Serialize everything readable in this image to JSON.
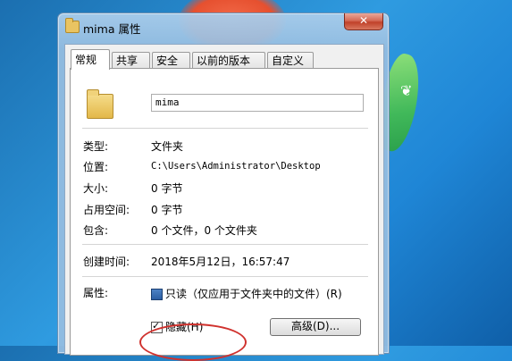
{
  "window": {
    "title": "mima 属性",
    "close_glyph": "✕"
  },
  "tabs": [
    {
      "label": "常规",
      "active": true
    },
    {
      "label": "共享",
      "active": false
    },
    {
      "label": "安全",
      "active": false
    },
    {
      "label": "以前的版本",
      "active": false
    },
    {
      "label": "自定义",
      "active": false
    }
  ],
  "folder_name": "mima",
  "props": {
    "type_label": "类型:",
    "type_value": "文件夹",
    "location_label": "位置:",
    "location_value": "C:\\Users\\Administrator\\Desktop",
    "size_label": "大小:",
    "size_value": "0 字节",
    "disk_label": "占用空间:",
    "disk_value": "0 字节",
    "contains_label": "包含:",
    "contains_value": "0 个文件，0 个文件夹",
    "created_label": "创建时间:",
    "created_value": "2018年5月12日，16:57:47",
    "attrs_label": "属性:"
  },
  "attributes": {
    "readonly_label": "只读（仅应用于文件夹中的文件）(R)",
    "hidden_label": "隐藏(H)",
    "hidden_checked": true,
    "advanced_button": "高级(D)..."
  },
  "colors": {
    "highlight_ellipse": "#d0322e"
  },
  "icons": [
    "folder-icon",
    "close-icon",
    "checkbox-icon"
  ]
}
